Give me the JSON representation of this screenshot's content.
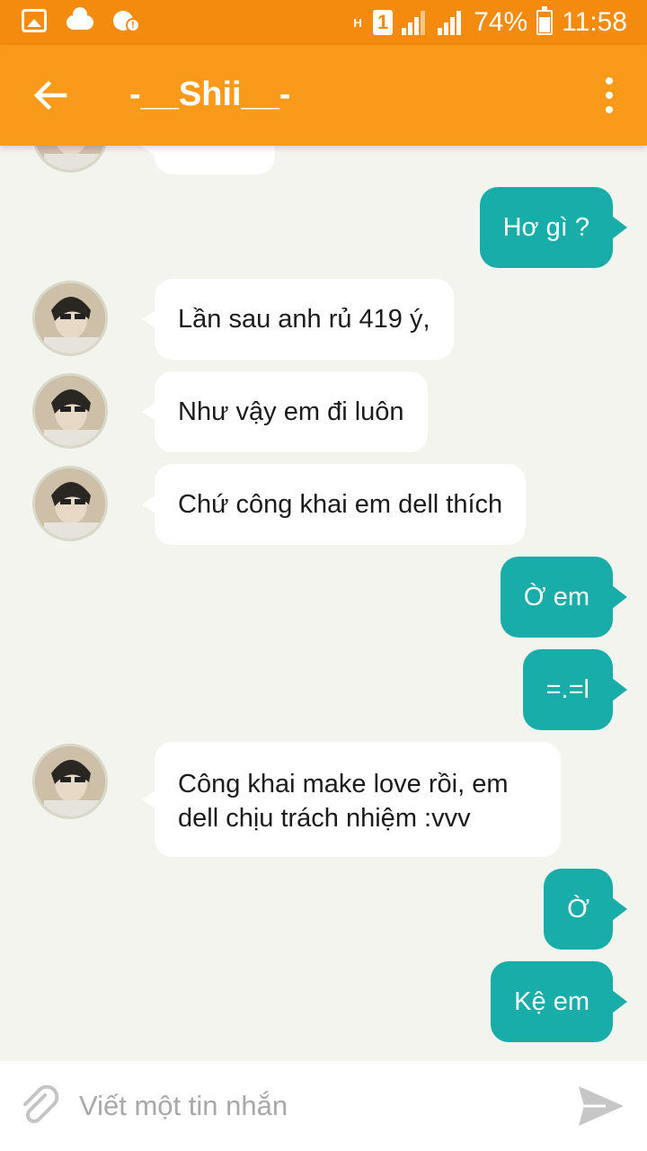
{
  "status_bar": {
    "battery_percent": "74%",
    "time": "11:58",
    "network": "H",
    "sim": "1"
  },
  "header": {
    "title": "-__Shii__-",
    "back_icon": "arrow-left-icon",
    "menu_icon": "more-vert-icon"
  },
  "messages": [
    {
      "direction": "in",
      "text": ""
    },
    {
      "direction": "out",
      "text": "Hơ gì ?"
    },
    {
      "direction": "in",
      "text": "Lần sau anh rủ 419 ý,"
    },
    {
      "direction": "in",
      "text": "Như vậy em đi luôn"
    },
    {
      "direction": "in",
      "text": "Chứ công khai em dell thích"
    },
    {
      "direction": "out",
      "text": "Ờ em"
    },
    {
      "direction": "out",
      "text": "=.=l"
    },
    {
      "direction": "in",
      "text": "Công khai make love rồi, em dell chịu trách nhiệm :vvv"
    },
    {
      "direction": "out",
      "text": "Ờ"
    },
    {
      "direction": "out",
      "text": "Kệ em"
    }
  ],
  "composer": {
    "placeholder": "Viết một tin nhắn",
    "attach_icon": "paperclip-icon",
    "send_icon": "send-icon"
  },
  "colors": {
    "status_bar": "#f48a0e",
    "app_bar": "#fa9a1a",
    "outgoing_bubble": "#19ada9",
    "incoming_bubble": "#ffffff",
    "background": "#f4f4ef"
  }
}
